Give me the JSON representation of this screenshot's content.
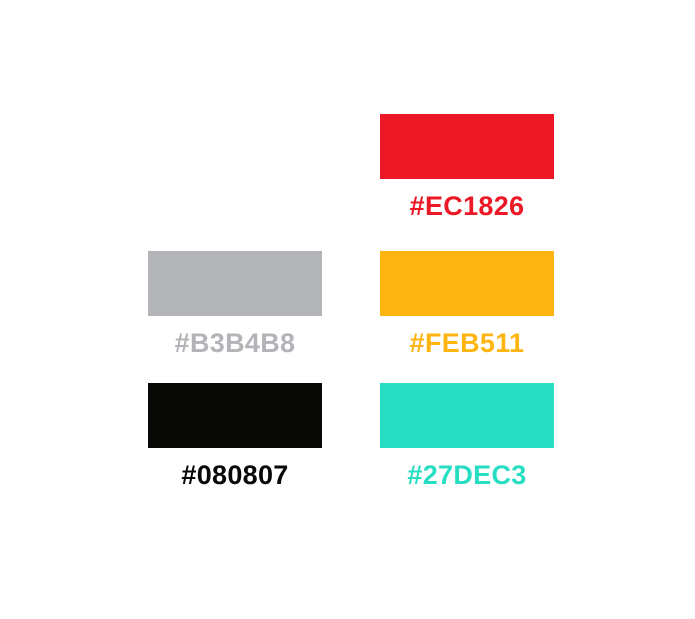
{
  "swatches": [
    {
      "id": "red",
      "label": "#EC1826",
      "color": "#EC1826"
    },
    {
      "id": "gray",
      "label": "#B3B4B8",
      "color": "#B3B4B8"
    },
    {
      "id": "gold",
      "label": "#FEB511",
      "color": "#FEB511"
    },
    {
      "id": "black",
      "label": "#080807",
      "color": "#080807"
    },
    {
      "id": "teal",
      "label": "#27DEC3",
      "color": "#27DEC3"
    }
  ]
}
